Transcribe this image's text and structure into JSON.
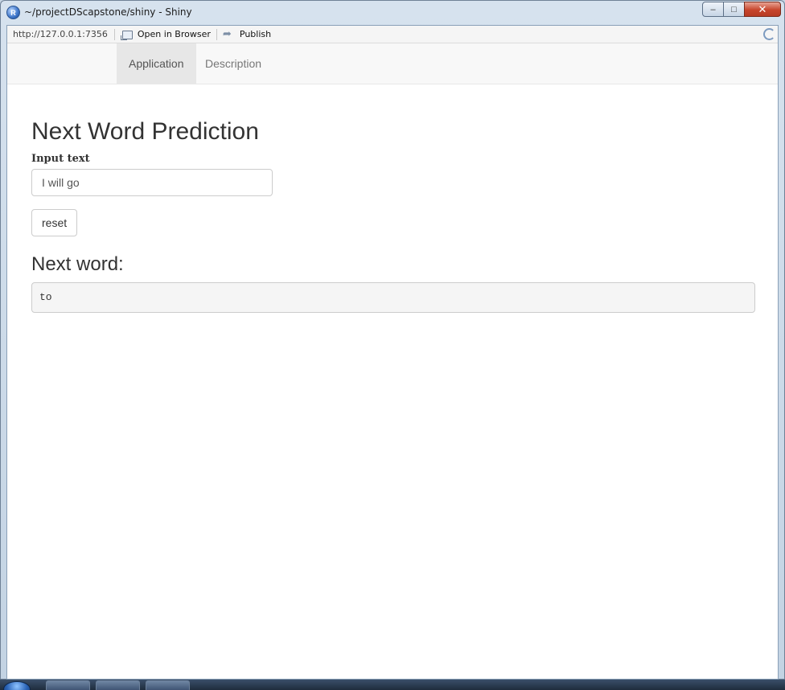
{
  "window": {
    "title": "~/projectDScapstone/shiny - Shiny"
  },
  "toolbar": {
    "url": "http://127.0.0.1:7356",
    "open_in_browser": "Open in Browser",
    "publish": "Publish"
  },
  "nav": {
    "tabs": [
      {
        "label": "Application",
        "active": true
      },
      {
        "label": "Description",
        "active": false
      }
    ]
  },
  "main": {
    "title": "Next Word Prediction",
    "input_label": "Input text",
    "input_value": "I will go",
    "reset_label": "reset",
    "output_heading": "Next word:",
    "output_value": "to"
  }
}
